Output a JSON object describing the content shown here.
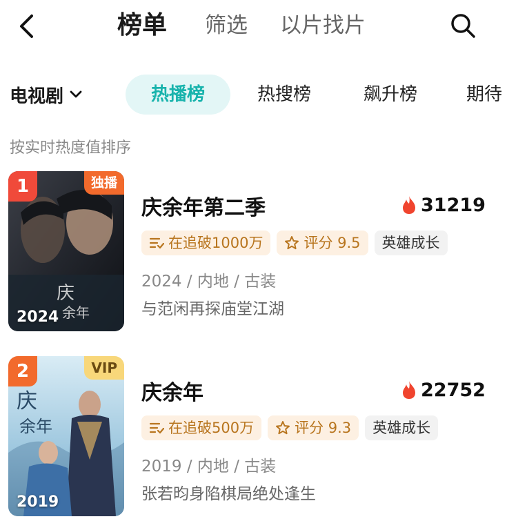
{
  "header": {
    "tabs": [
      {
        "label": "榜单"
      },
      {
        "label": "筛选"
      },
      {
        "label": "以片找片"
      }
    ]
  },
  "filters": {
    "category": "电视剧",
    "rank_tabs": [
      {
        "label": "热播榜",
        "active": true
      },
      {
        "label": "热搜榜",
        "active": false
      },
      {
        "label": "飙升榜",
        "active": false
      },
      {
        "label": "期待",
        "active": false
      }
    ]
  },
  "sort_hint": "按实时热度值排序",
  "items": [
    {
      "rank": "1",
      "corner_tag": "独播",
      "poster_year": "2024",
      "title": "庆余年第二季",
      "heat": "31219",
      "tag_follow": "在追破1000万",
      "tag_score": "评分 9.5",
      "tag_theme": "英雄成长",
      "meta": "2024 / 内地 / 古装",
      "desc": "与范闲再探庙堂江湖"
    },
    {
      "rank": "2",
      "corner_tag": "VIP",
      "poster_year": "2019",
      "title": "庆余年",
      "heat": "22752",
      "tag_follow": "在追破500万",
      "tag_score": "评分 9.3",
      "tag_theme": "英雄成长",
      "meta": "2019 / 内地 / 古装",
      "desc": "张若昀身陷棋局绝处逢生"
    }
  ],
  "colors": {
    "accent_teal": "#18b3ac",
    "active_tab_bg": "#e3f6f6",
    "rank1_badge": "#f04a3a",
    "rank2_badge": "#f26a2c",
    "heat_flame": "#f0442e",
    "warm_tag_bg": "#fdf0e2",
    "warm_tag_text": "#b8751e"
  }
}
